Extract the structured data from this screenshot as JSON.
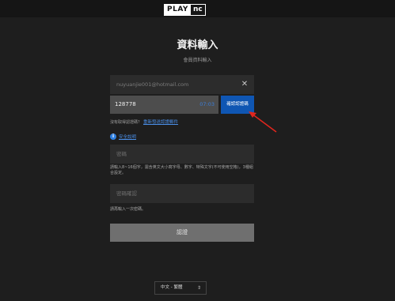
{
  "header": {
    "logo_left": "PLAY",
    "logo_right": "nc"
  },
  "page": {
    "title": "資料輸入",
    "subtitle": "會員資料輸入"
  },
  "email": {
    "value": "nuyuanjie001@hotmail.com",
    "clear_icon": "close-icon"
  },
  "code": {
    "value": "128778",
    "timer": "07:03",
    "verify_label": "確認認證碼"
  },
  "resend": {
    "prompt": "沒有取得認證碼？",
    "link": "重新發送認證郵件"
  },
  "security": {
    "icon": "info-icon",
    "link": "安全說明"
  },
  "password": {
    "placeholder": "密碼",
    "hint": "請輸入8~16個字，需含英文大小寫字母、數字、特殊文字(不可使用空格)，3種組合設定。"
  },
  "password_confirm": {
    "placeholder": "密碼確認",
    "hint": "請再輸入一次密碼。"
  },
  "submit": {
    "label": "認證"
  },
  "language": {
    "selected": "中文 - 繁體"
  },
  "colors": {
    "accent": "#0f56b3",
    "link": "#4a8ee6",
    "annotation_arrow": "#e2261d"
  }
}
